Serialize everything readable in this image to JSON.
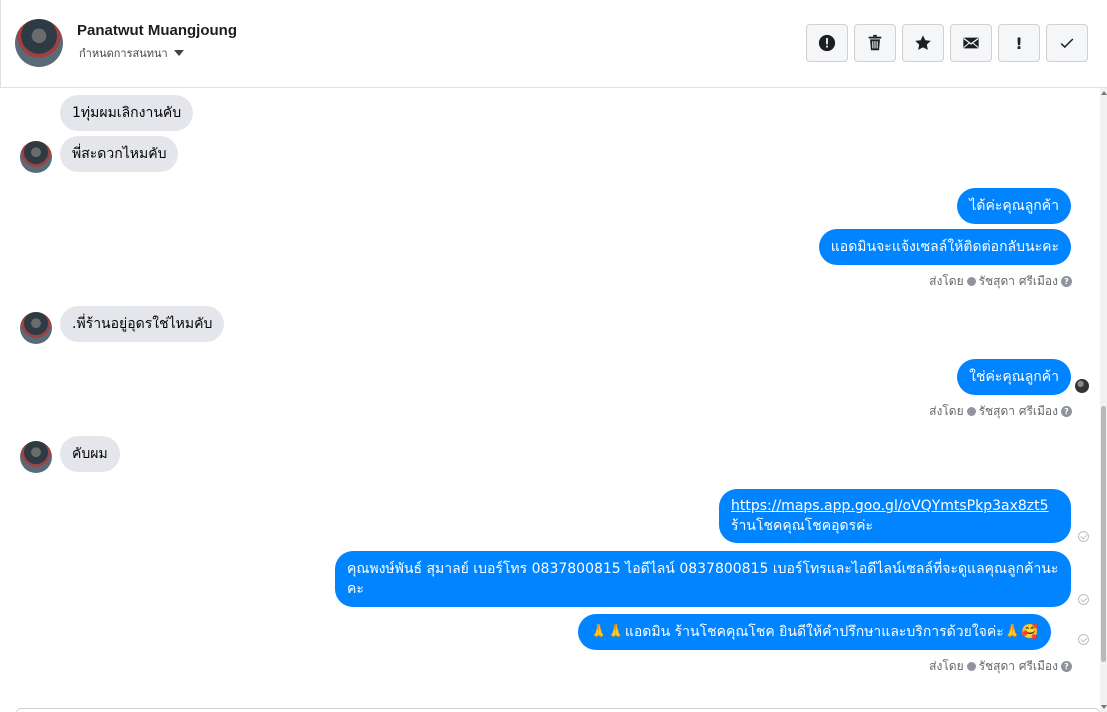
{
  "header": {
    "name": "Panatwut Muangjoung",
    "assign_label": "กำหนดการสนทนา",
    "actions": [
      {
        "name": "report-button",
        "icon": "exclamation-circle-icon"
      },
      {
        "name": "delete-button",
        "icon": "trash-icon"
      },
      {
        "name": "star-button",
        "icon": "star-icon"
      },
      {
        "name": "mark-unread-button",
        "icon": "envelope-icon"
      },
      {
        "name": "flag-button",
        "icon": "exclamation-icon",
        "glyph": "!"
      },
      {
        "name": "done-button",
        "icon": "check-icon"
      }
    ]
  },
  "messages": {
    "m1": "1ทุ่มผมเลิกงานคับ",
    "m2": "พี่สะดวกไหมคับ",
    "m3": "ได้ค่ะคุณลูกค้า",
    "m4": "แอดมินจะแจ้งเซลล์ให้ติดต่อกลับนะคะ",
    "m5": ".พี่ร้านอยู่อุดรใช่ไหมคับ",
    "m6": "ใช่ค่ะคุณลูกค้า",
    "m7": "คับผม",
    "m8_link": "https://maps.app.goo.gl/oVQYmtsPkp3ax8zt5",
    "m8_text": "ร้านโชคคุณโชคอุดรค่ะ",
    "m9": "คุณพงษ์พันธ์ สุมาลย์      เบอร์โทร 0837800815  ไอดีไลน์ 0837800815   เบอร์โทรและไอดีไลน์เซลล์ที่จะดูแลคุณลูกค้านะคะ",
    "m10": "🙏🙏แอดมิน ร้านโชคคุณโชค ยินดีให้คำปรึกษาและบริการด้วยใจค่ะ🙏🥰"
  },
  "sent_by": {
    "prefix": "ส่งโดย",
    "agent": "รัชสุดา ศรีเมือง",
    "help": "?"
  },
  "colors": {
    "outgoing_bubble": "#0084ff",
    "incoming_bubble": "#e4e6eb"
  }
}
